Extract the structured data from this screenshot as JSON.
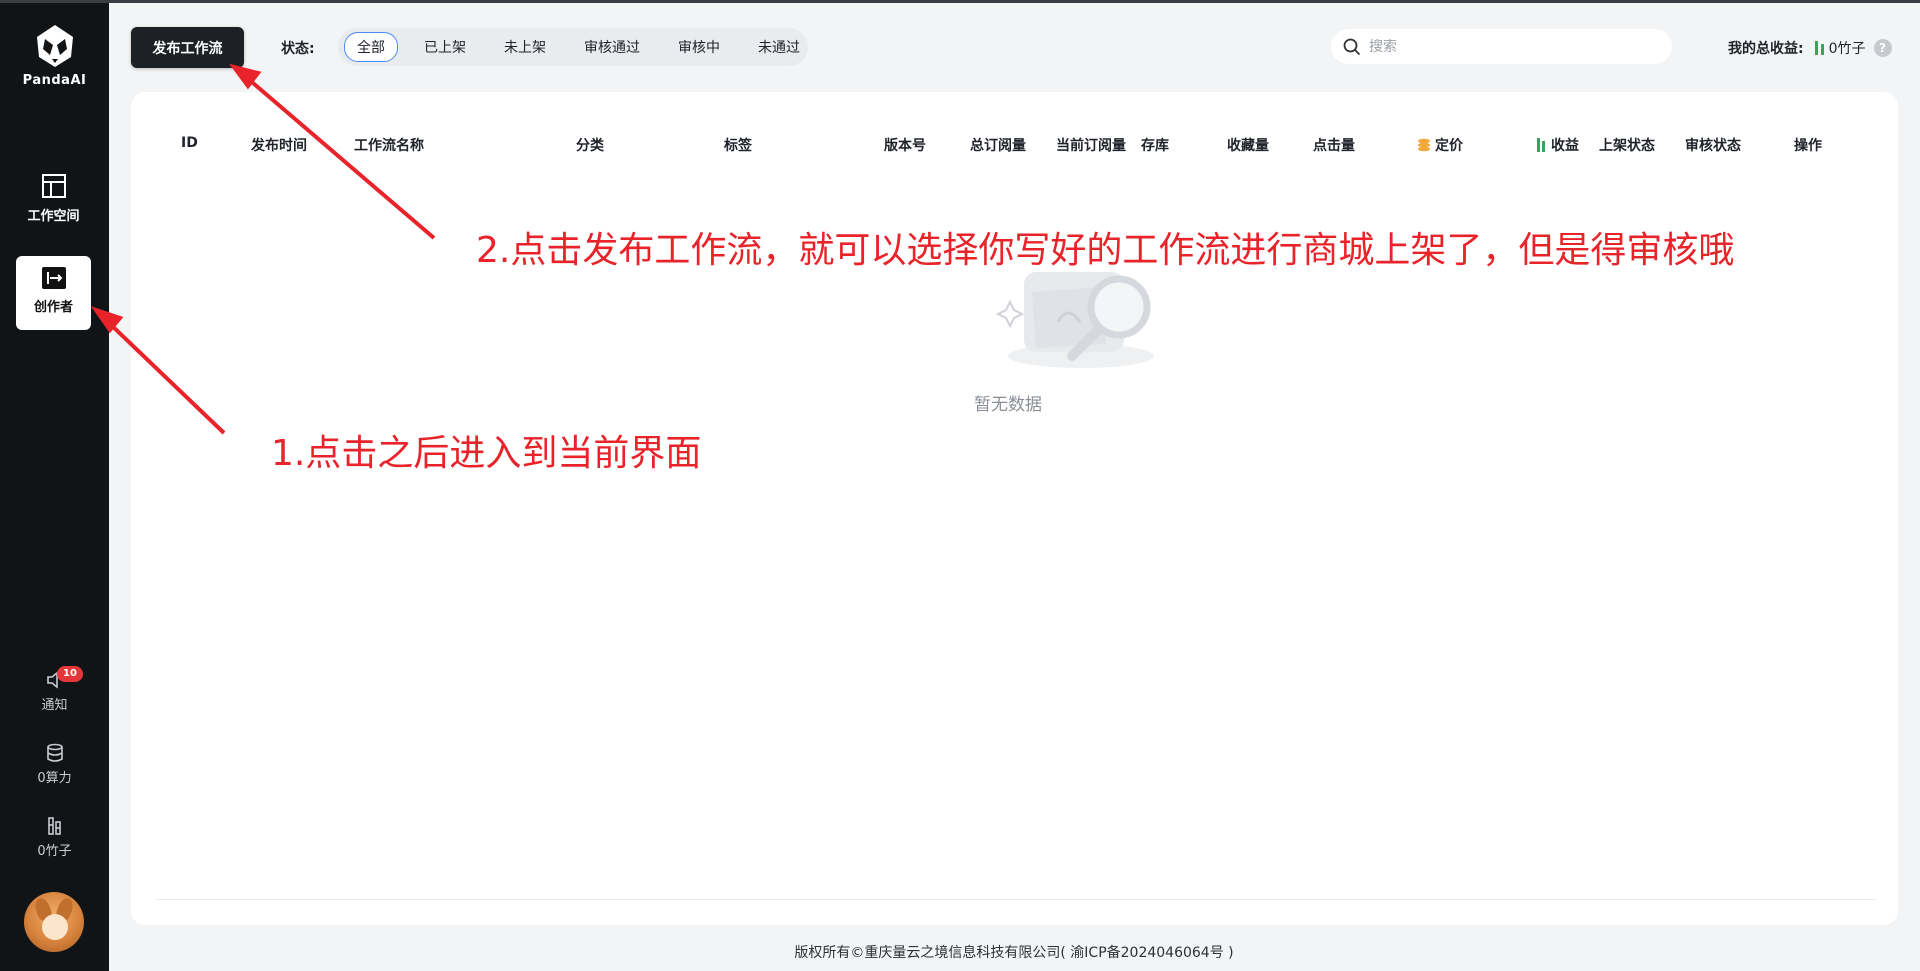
{
  "sidebar": {
    "logo_text": "PandaAI",
    "nav": [
      {
        "label": "工作空间",
        "icon": "layout-icon"
      },
      {
        "label": "创作者",
        "icon": "creator-icon"
      }
    ],
    "bottom": {
      "notify_label": "通知",
      "notify_badge": "10",
      "compute_label": "0算力",
      "bamboo_label": "0竹子"
    }
  },
  "toolbar": {
    "publish_label": "发布工作流",
    "status_label": "状态:",
    "status_tabs": [
      "全部",
      "已上架",
      "未上架",
      "审核通过",
      "审核中",
      "未通过"
    ],
    "active_tab": "全部",
    "search_placeholder": "搜索",
    "earnings_label": "我的总收益:",
    "earnings_value": "0竹子",
    "help_glyph": "?"
  },
  "table": {
    "columns": [
      "ID",
      "发布时间",
      "工作流名称",
      "分类",
      "标签",
      "版本号",
      "总订阅量",
      "当前订阅量",
      "存库",
      "收藏量",
      "点击量",
      "定价",
      "收益",
      "上架状态",
      "审核状态",
      "操作"
    ],
    "empty_text": "暂无数据"
  },
  "annotations": {
    "step1": "1.点击之后进入到当前界面",
    "step2": "2.点击发布工作流，就可以选择你写好的工作流进行商城上架了，但是得审核哦"
  },
  "footer": {
    "text": "版权所有©重庆量云之境信息科技有限公司( 渝ICP备2024046064号 )"
  },
  "colors": {
    "sidebar_bg": "#111416",
    "primary_btn": "#1d2126",
    "active_tab_border": "#4a8cf7",
    "annotation_red": "#e8232a",
    "badge_red": "#e5373a"
  }
}
